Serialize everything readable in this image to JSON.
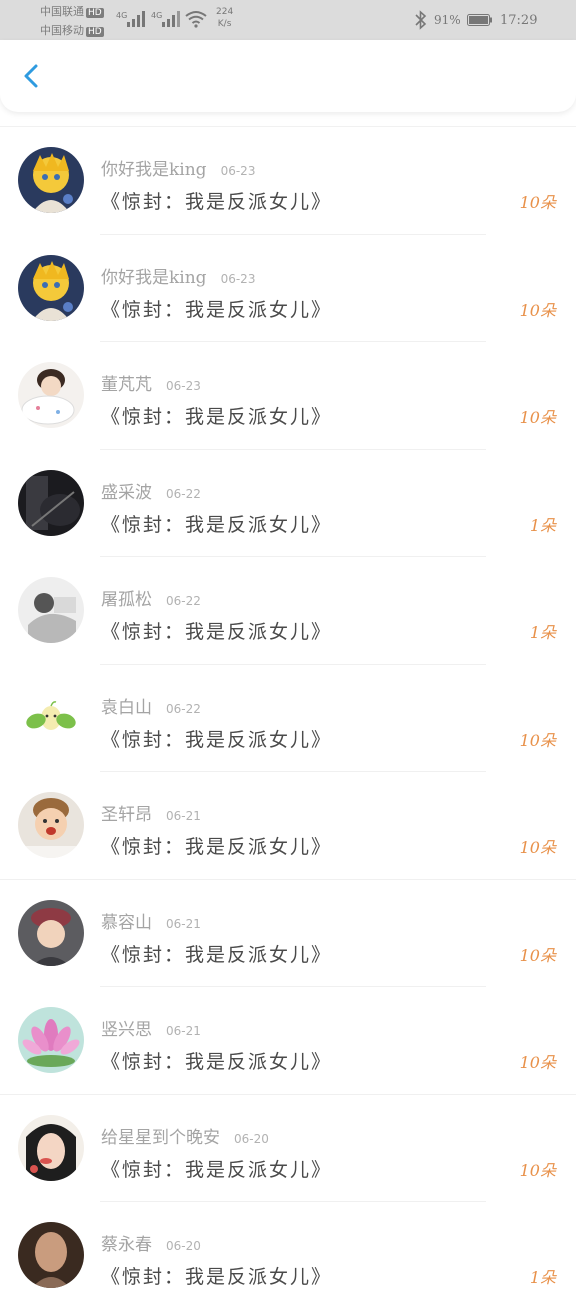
{
  "status_bar": {
    "carrier1": "中国联通",
    "carrier2": "中国移动",
    "hd": "HD",
    "net1": "4G",
    "net2": "4G",
    "speed_value": "224",
    "speed_unit": "K/s",
    "battery": "91%",
    "time": "17:29"
  },
  "nav": {
    "back_icon": "chevron-left-icon",
    "accent": "#2f9be0"
  },
  "count_color": "#e8914a",
  "rows": [
    {
      "name": "你好我是king",
      "date": "06-23",
      "title": "《惊封：我是反派女儿》",
      "count": "10朵"
    },
    {
      "name": "你好我是king",
      "date": "06-23",
      "title": "《惊封：我是反派女儿》",
      "count": "10朵"
    },
    {
      "name": "董芃芃",
      "date": "06-23",
      "title": "《惊封：我是反派女儿》",
      "count": "10朵"
    },
    {
      "name": "盛采波",
      "date": "06-22",
      "title": "《惊封：我是反派女儿》",
      "count": "1朵"
    },
    {
      "name": "屠孤松",
      "date": "06-22",
      "title": "《惊封：我是反派女儿》",
      "count": "1朵"
    },
    {
      "name": "袁白山",
      "date": "06-22",
      "title": "《惊封：我是反派女儿》",
      "count": "10朵"
    },
    {
      "name": "圣轩昂",
      "date": "06-21",
      "title": "《惊封：我是反派女儿》",
      "count": "10朵"
    },
    {
      "name": "慕容山",
      "date": "06-21",
      "title": "《惊封：我是反派女儿》",
      "count": "10朵"
    },
    {
      "name": "竖兴思",
      "date": "06-21",
      "title": "《惊封：我是反派女儿》",
      "count": "10朵"
    },
    {
      "name": "给星星到个晚安",
      "date": "06-20",
      "title": "《惊封：我是反派女儿》",
      "count": "10朵"
    },
    {
      "name": "蔡永春",
      "date": "06-20",
      "title": "《惊封：我是反派女儿》",
      "count": "1朵"
    }
  ]
}
